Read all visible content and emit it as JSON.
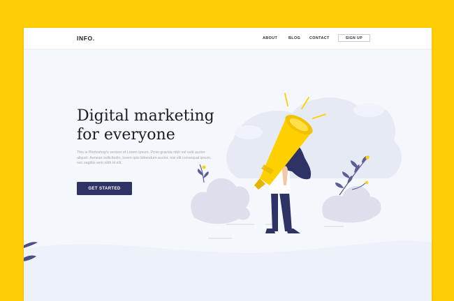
{
  "header": {
    "logo": "INFO.",
    "nav": [
      {
        "label": "ABOUT"
      },
      {
        "label": "BLOG"
      },
      {
        "label": "CONTACT"
      }
    ],
    "signup_label": "SIGN UP"
  },
  "hero": {
    "title_line1": "Digital marketing",
    "title_line2": "for everyone",
    "description": "This is Photoshop's version of Lorem Ipsum. Proin gravida nibh vel velit auctor aliquet. Aenean sollicitudin, lorem quis bibendum auctor, nisi elit consequat ipsum, nec sagittis sem nibh id elit.",
    "cta_label": "GET STARTED"
  },
  "colors": {
    "background": "#FFCD05",
    "page": "#F4F7FC",
    "primary": "#2F3264",
    "accent_yellow": "#FFD000",
    "text_dark": "#1D1D28",
    "text_muted": "#A3A7B5"
  },
  "illustration": {
    "subject": "woman-holding-megaphone"
  }
}
